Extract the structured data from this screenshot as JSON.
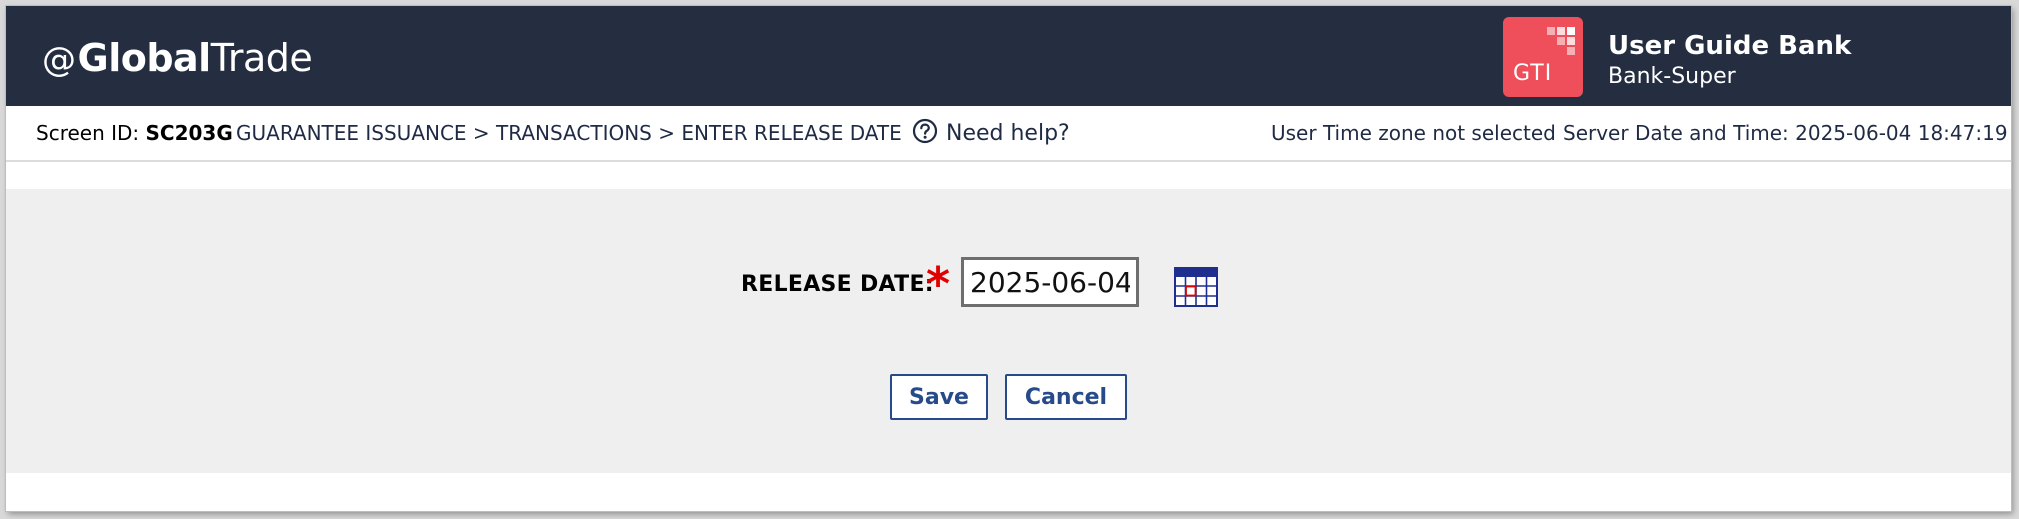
{
  "header": {
    "brand_at": "@",
    "brand_bold": "Global",
    "brand_light": "Trade",
    "logo_text": "GTI",
    "user_name": "User Guide Bank",
    "user_role": "Bank-Super",
    "background": "#252e41",
    "logo_color": "#ef4f5a"
  },
  "infobar": {
    "screen_id_label": "Screen ID:",
    "screen_id": "SC203G",
    "breadcrumb": "GUARANTEE ISSUANCE > TRANSACTIONS > ENTER RELEASE DATE",
    "help_label": "Need help?",
    "timezone": "User Time zone not selected",
    "server_time": "Server Date and Time: 2025-06-04 18:47:19"
  },
  "form": {
    "release_date_label": "RELEASE DATE:",
    "required_mark": "*",
    "release_date_value": "2025-06-04",
    "save_label": "Save",
    "cancel_label": "Cancel",
    "accent": "#274a8a",
    "required_color": "#e00000"
  },
  "icons": {
    "help": "question-circle-icon",
    "calendar": "calendar-icon"
  }
}
